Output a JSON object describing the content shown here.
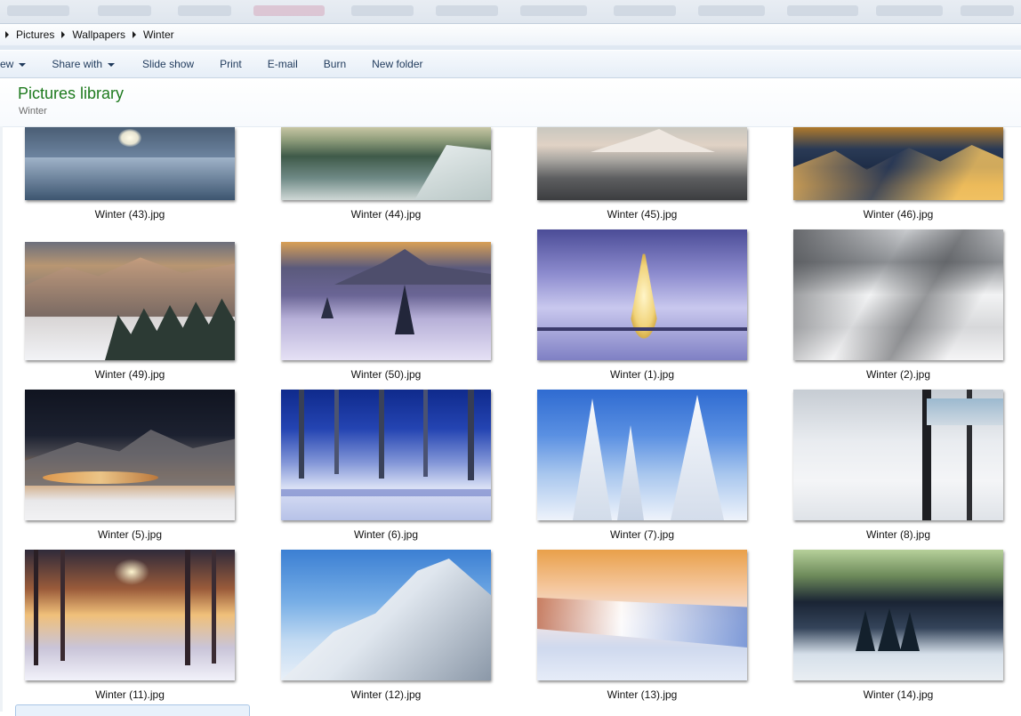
{
  "breadcrumb": [
    "Pictures",
    "Wallpapers",
    "Winter"
  ],
  "toolbar": {
    "view_label": "ew",
    "share_label": "Share with",
    "slideshow_label": "Slide show",
    "print_label": "Print",
    "email_label": "E-mail",
    "burn_label": "Burn",
    "newfolder_label": "New folder"
  },
  "library": {
    "title": "Pictures library",
    "subtitle": "Winter"
  },
  "files": [
    "Winter (43).jpg",
    "Winter (44).jpg",
    "Winter (45).jpg",
    "Winter (46).jpg",
    "Winter (49).jpg",
    "Winter (50).jpg",
    "Winter (1).jpg",
    "Winter (2).jpg",
    "Winter (5).jpg",
    "Winter (6).jpg",
    "Winter (7).jpg",
    "Winter (8).jpg",
    "Winter (11).jpg",
    "Winter (12).jpg",
    "Winter (13).jpg",
    "Winter (14).jpg"
  ]
}
